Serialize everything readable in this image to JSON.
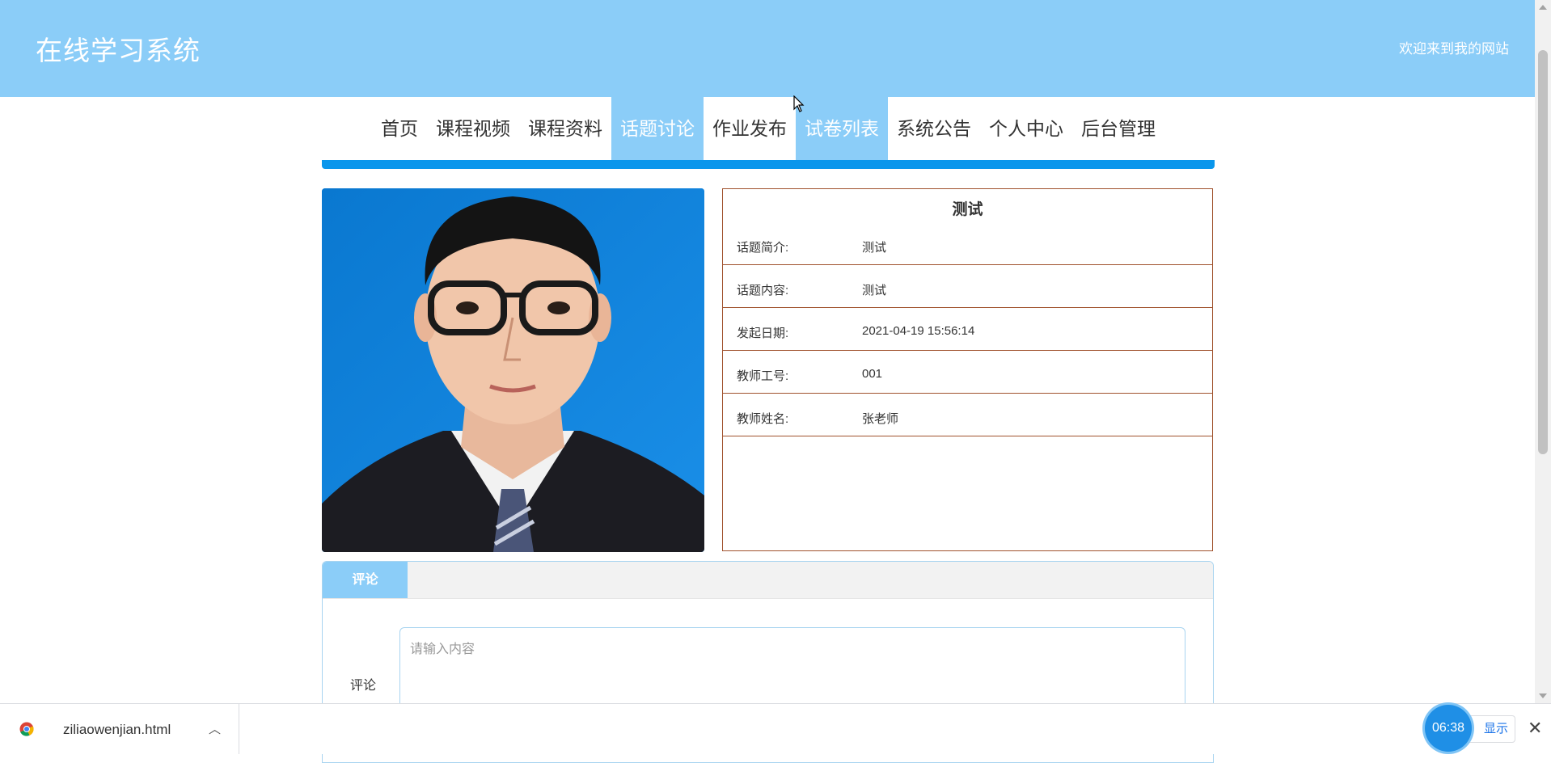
{
  "header": {
    "site_title": "在线学习系统",
    "welcome": "欢迎来到我的网站",
    "background_color": "#8bcdf8"
  },
  "nav": {
    "items": [
      {
        "label": "首页",
        "active": false
      },
      {
        "label": "课程视频",
        "active": false
      },
      {
        "label": "课程资料",
        "active": false
      },
      {
        "label": "话题讨论",
        "active": true
      },
      {
        "label": "作业发布",
        "active": false
      },
      {
        "label": "试卷列表",
        "active": true
      },
      {
        "label": "系统公告",
        "active": false
      },
      {
        "label": "个人中心",
        "active": false
      },
      {
        "label": "后台管理",
        "active": false
      }
    ],
    "bar_color": "#0a96ec"
  },
  "topic": {
    "title": "测试",
    "rows": [
      {
        "key": "话题简介:",
        "value": "测试"
      },
      {
        "key": "话题内容:",
        "value": "测试"
      },
      {
        "key": "发起日期:",
        "value": "2021-04-19 15:56:14"
      },
      {
        "key": "教师工号:",
        "value": "001"
      },
      {
        "key": "教师姓名:",
        "value": "张老师"
      }
    ],
    "border_color": "#a0522d"
  },
  "comment": {
    "tab_label": "评论",
    "field_label": "评论",
    "placeholder": "请输入内容",
    "value": ""
  },
  "download_bar": {
    "file_name": "ziliaowenjian.html",
    "show_all_label": "显示",
    "timer": "06:38",
    "icons": [
      "chrome-icon",
      "chevron-up-icon",
      "close-icon"
    ]
  }
}
